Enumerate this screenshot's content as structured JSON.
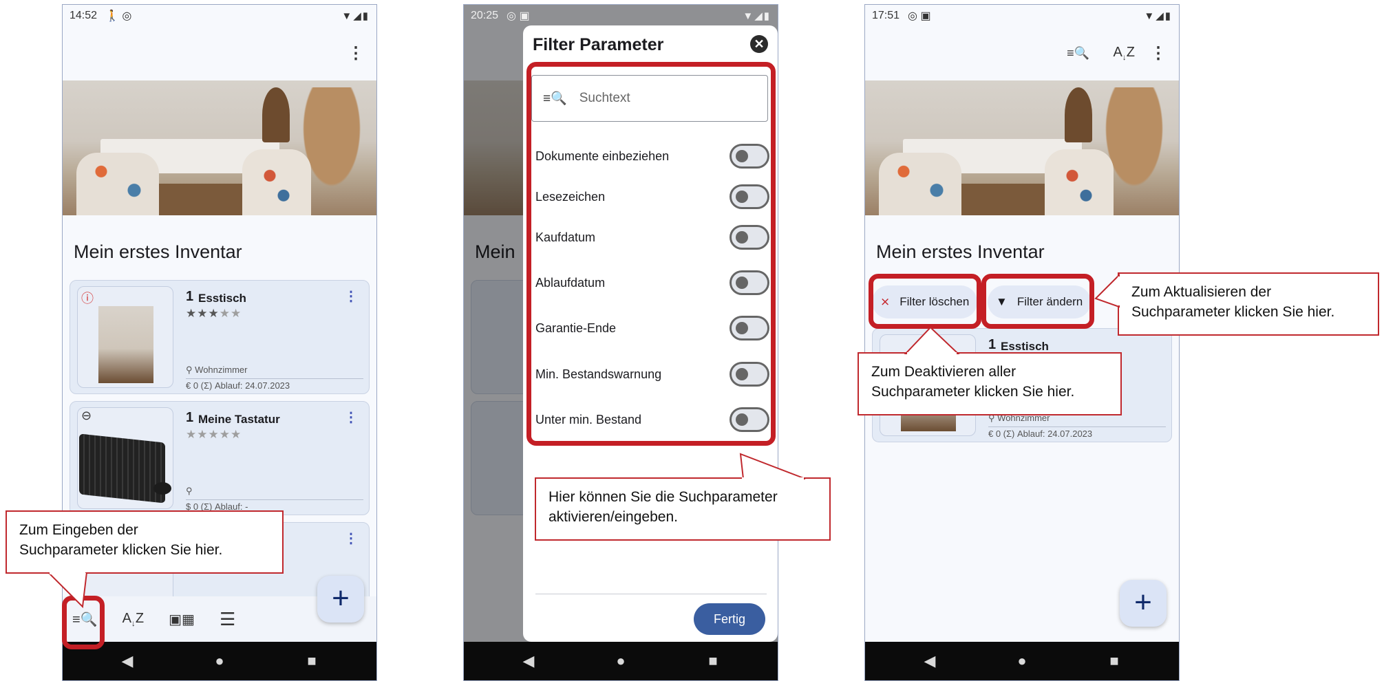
{
  "screen1": {
    "status_time": "14:52",
    "status_left_icons": "🚶 ◎",
    "status_right_icons": "▼◢▮",
    "menu_icon": "⋮",
    "inventory_title": "Mein erstes Inventar",
    "items": [
      {
        "qty": "1",
        "name": "Esstisch",
        "badge": "!",
        "badge_icon": "alert-circle-icon",
        "stars_filled": 3,
        "stars_total": 5,
        "location": "Wohnzimmer",
        "meta": "€ 0  (Σ)  Ablauf: 24.07.2023"
      },
      {
        "qty": "1",
        "name": "Meine Tastatur",
        "badge": "⊖",
        "badge_icon": "link-icon",
        "stars_filled": 0,
        "stars_total": 5,
        "location": "",
        "meta": "$ 0  (Σ)  Ablauf: -"
      }
    ],
    "fab_label": "+",
    "tools": [
      "search-filter-icon",
      "sort-az-icon",
      "gallery-view-icon",
      "list-view-icon"
    ],
    "tool_glyphs": [
      "≡🔍",
      "A͎Z",
      "▣▦",
      "☰"
    ],
    "callout": "Zum Eingeben der\nSuchparameter klicken Sie hier."
  },
  "screen2": {
    "status_time": "20:25",
    "status_left_icons": "◎ ▣",
    "status_right_icons": "▼◢▮",
    "dialog_title": "Filter Parameter",
    "close_glyph": "✕",
    "search_placeholder": "Suchtext",
    "toggles": [
      "Dokumente einbeziehen",
      "Lesezeichen",
      "Kaufdatum",
      "Ablaufdatum",
      "Garantie-Ende",
      "Min. Bestandswarnung",
      "Unter min. Bestand"
    ],
    "toggle_states": [
      false,
      false,
      false,
      false,
      false,
      false,
      false
    ],
    "background_title": "Mein",
    "done_label": "Fertig",
    "callout": "Hier können Sie die Suchparameter\naktivieren/eingeben."
  },
  "screen3": {
    "status_time": "17:51",
    "status_left_icons": "◎ ▣",
    "status_right_icons": "▼◢▮",
    "inventory_title": "Mein erstes Inventar",
    "clear_filter_label": "Filter löschen",
    "change_filter_label": "Filter ändern",
    "item": {
      "qty": "1",
      "name": "Esstisch",
      "location": "Wohnzimmer",
      "meta": "€ 0  (Σ)  Ablauf: 24.07.2023"
    },
    "fab_label": "+",
    "callout_update": "Zum Aktualisieren der\nSuchparameter klicken Sie hier.",
    "callout_clear": "Zum Deaktivieren aller\nSuchparameter klicken Sie hier."
  },
  "nav": {
    "back": "◀",
    "home": "●",
    "recents": "■"
  },
  "colors": {
    "highlight_red": "#c41f25",
    "fab_bg": "#dbe4f6",
    "button_blue": "#3a5ea0"
  }
}
